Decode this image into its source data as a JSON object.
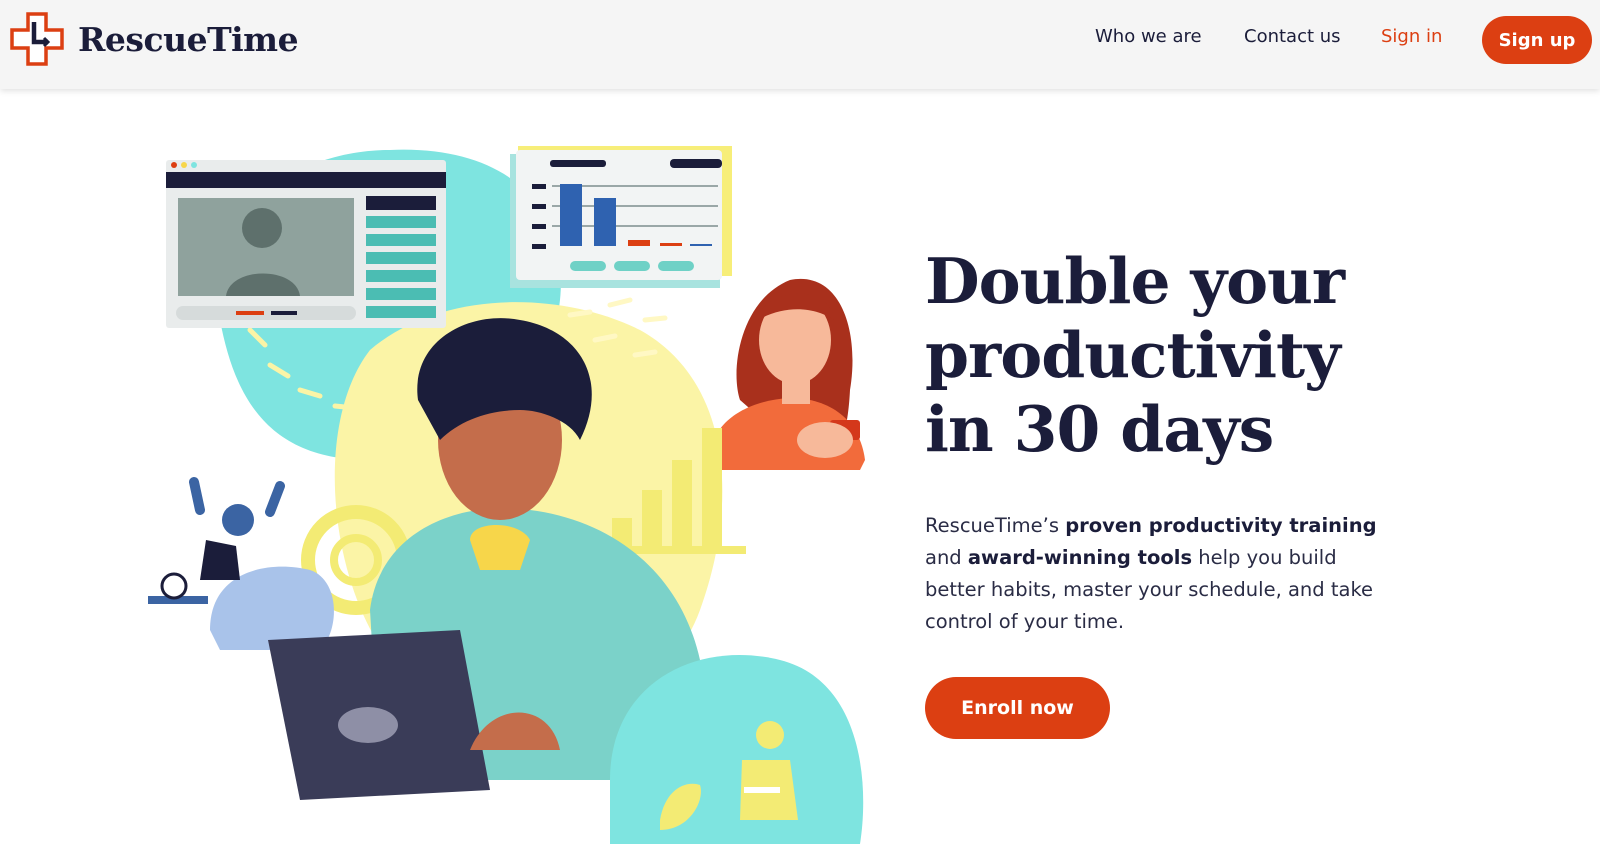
{
  "header": {
    "brand": "RescueTime",
    "nav": {
      "who_we_are": "Who we are",
      "contact_us": "Contact us",
      "sign_in": "Sign in",
      "sign_up": "Sign up"
    }
  },
  "hero": {
    "title_lines": [
      "Double your",
      "productivity",
      "in 30 days"
    ],
    "description": {
      "part1": "RescueTime’s ",
      "bold1": "proven productivity training",
      "part2": " and ",
      "bold2": "award-winning tools",
      "part3": " help you build better habits, master your schedule, and take control of your time."
    },
    "cta": "Enroll now"
  },
  "colors": {
    "accent": "#dc3f12",
    "navy": "#1b1d3a",
    "teal": "#7ee4e0",
    "yellow": "#fbf4a6"
  },
  "icons": {
    "logo": "rescuetime-clock-cross-icon"
  }
}
